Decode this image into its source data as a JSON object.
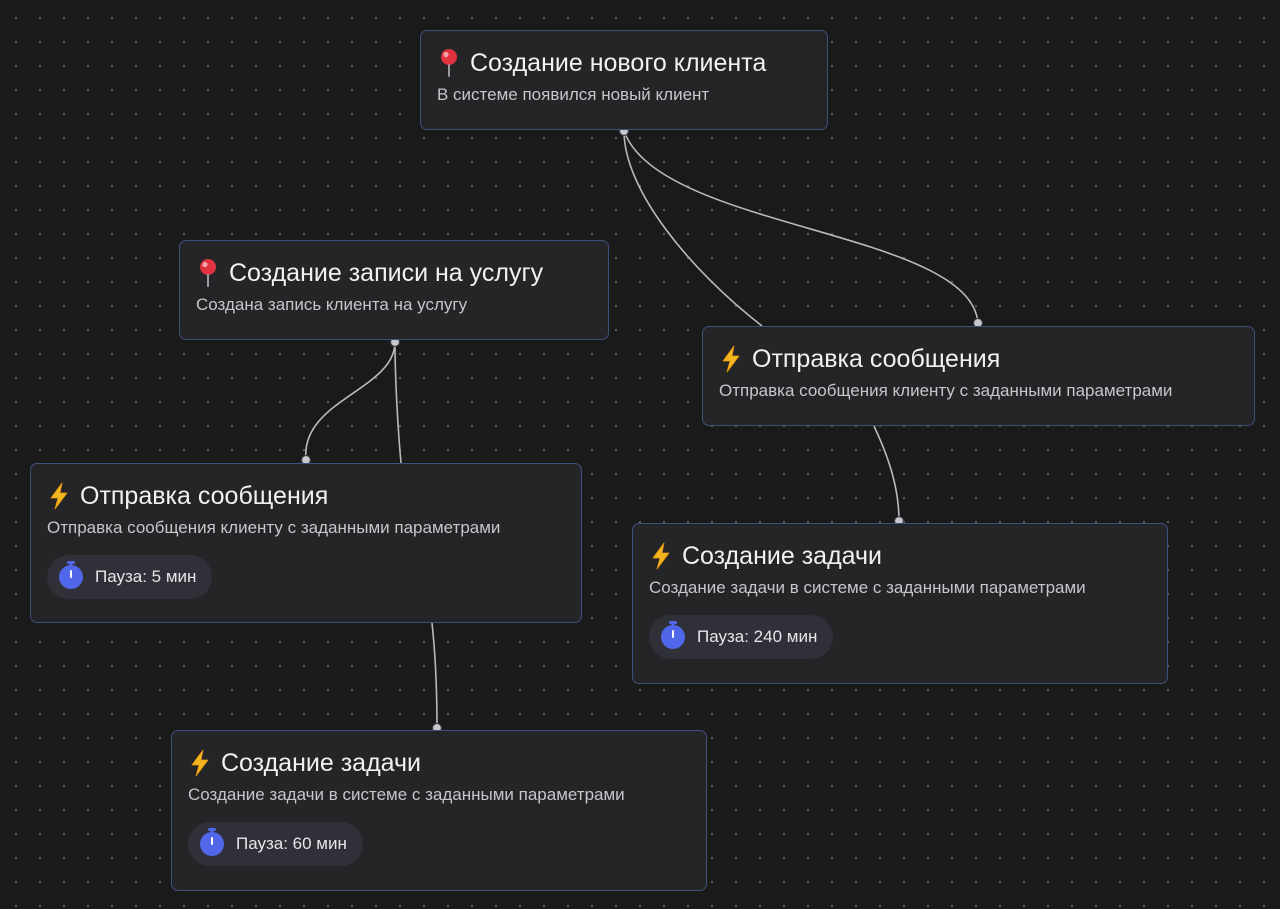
{
  "canvas": {
    "background": "#1a1a1b",
    "dot_color": "#5b5b5f",
    "edge_color": "#b9b9be",
    "node_border_color": "#3e4f7a",
    "timer_icon_color": "#4f67e8"
  },
  "nodes": [
    {
      "id": "trigger-new-client",
      "kind": "trigger",
      "icon": "pin-icon",
      "title": "Создание нового клиента",
      "description": "В системе появился новый клиент"
    },
    {
      "id": "trigger-booking",
      "kind": "trigger",
      "icon": "pin-icon",
      "title": "Создание записи на услугу",
      "description": "Создана запись клиента на услугу"
    },
    {
      "id": "action-send-message-right",
      "kind": "action",
      "icon": "lightning-icon",
      "title": "Отправка сообщения",
      "description": "Отправка сообщения клиенту с заданными параметрами"
    },
    {
      "id": "action-send-message-left",
      "kind": "action",
      "icon": "lightning-icon",
      "title": "Отправка сообщения",
      "description": "Отправка сообщения клиенту с заданными параметрами",
      "pause_label": "Пауза: 5 мин"
    },
    {
      "id": "action-create-task-right",
      "kind": "action",
      "icon": "lightning-icon",
      "title": "Создание задачи",
      "description": "Создание задачи в системе с заданными параметрами",
      "pause_label": "Пауза: 240 мин"
    },
    {
      "id": "action-create-task-left",
      "kind": "action",
      "icon": "lightning-icon",
      "title": "Создание задачи",
      "description": "Создание задачи в системе с заданными параметрами",
      "pause_label": "Пауза: 60 мин"
    }
  ],
  "edges": [
    {
      "from": "trigger-new-client",
      "to": "action-send-message-right"
    },
    {
      "from": "trigger-new-client",
      "to": "action-send-message-right"
    },
    {
      "from": "trigger-booking",
      "to": "action-send-message-left"
    },
    {
      "from": "trigger-booking",
      "to": "action-send-message-left"
    },
    {
      "from": "action-send-message-right",
      "to": "action-create-task-right"
    },
    {
      "from": "action-send-message-left",
      "to": "action-create-task-left"
    }
  ]
}
